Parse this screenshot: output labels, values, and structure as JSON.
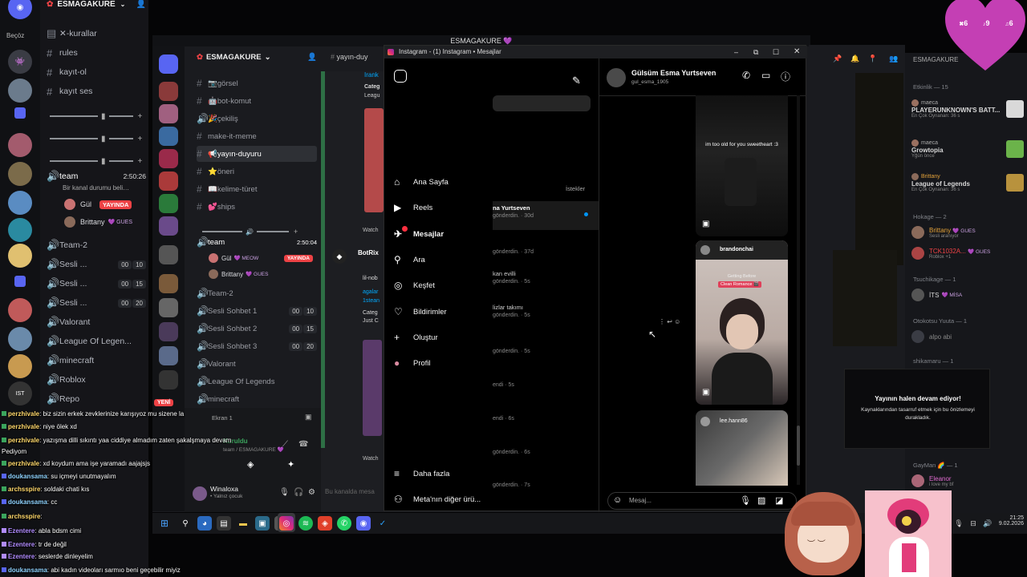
{
  "discord_rail": {
    "top_label": "Beçöz"
  },
  "discord_sidebar": {
    "server_name": "ESMAGAKURE",
    "channels": [
      {
        "icon": "#",
        "label": "✕-kurallar"
      },
      {
        "icon": "#",
        "label": "rules"
      },
      {
        "icon": "#",
        "label": "kayıt-ol"
      },
      {
        "icon": "#",
        "label": "kayıt ses"
      }
    ],
    "voice_team": {
      "name": "team",
      "time": "2:50:26",
      "status": "Bir kanal durumu beli…"
    },
    "voice_members": [
      {
        "name": "Gül",
        "badge": "YAYINDA"
      },
      {
        "name": "Brittany",
        "tag": "💜 GUES"
      }
    ],
    "voice_channels": [
      {
        "label": "Team-2"
      },
      {
        "label": "Sesli ...",
        "a": "00",
        "b": "10"
      },
      {
        "label": "Sesli ...",
        "a": "00",
        "b": "15"
      },
      {
        "label": "Sesli ...",
        "a": "00",
        "b": "20"
      },
      {
        "label": "Valorant"
      },
      {
        "label": "League Of Legen..."
      },
      {
        "label": "minecraft"
      },
      {
        "label": "Roblox"
      },
      {
        "label": "Repo"
      }
    ]
  },
  "discord_window": {
    "title": "ESMAGAKURE 💜",
    "server_name": "ESMAGAKURE",
    "channels": [
      {
        "icon": "#",
        "label": "📷görsel"
      },
      {
        "icon": "#",
        "label": "🤖bot-komut"
      },
      {
        "icon": "🔊",
        "label": "🎉çekiliş"
      },
      {
        "icon": "#",
        "label": "make-it-meme"
      },
      {
        "icon": "#",
        "label": "📢yayın-duyuru"
      },
      {
        "icon": "#",
        "label": "⭐öneri"
      },
      {
        "icon": "#",
        "label": "📖kelime-türet"
      },
      {
        "icon": "#",
        "label": "💕ships"
      }
    ],
    "voice_team": {
      "name": "team",
      "time": "2:50:04"
    },
    "voice_members": [
      {
        "name": "Gül",
        "tag": "💜 MEOW",
        "badge": "YAYINDA"
      },
      {
        "name": "Brittany",
        "tag": "💜 GUES"
      }
    ],
    "voice_channels": [
      {
        "label": "Team-2"
      },
      {
        "label": "Sesli Sohbet 1",
        "a": "00",
        "b": "10"
      },
      {
        "label": "Sesli Sohbet 2",
        "a": "00",
        "b": "15"
      },
      {
        "label": "Sesli Sohbet 3",
        "a": "00",
        "b": "20"
      },
      {
        "label": "Valorant"
      },
      {
        "label": "League Of Legends"
      },
      {
        "label": "minecraft"
      }
    ],
    "new_badge": "YENİ",
    "bot_name": "BotRix",
    "partial_texts": [
      "Irank",
      "Categ",
      "Leagu",
      "Watch",
      "lil-nob",
      "agalar",
      "1stean",
      "Categ",
      "Just C",
      "Watch"
    ],
    "channel_header": "yayın-duy",
    "user": {
      "name": "Winaloxa",
      "status": "• Yalnız çocuk"
    },
    "message_placeholder": "Bu kanalda mesa",
    "screen_label": "Ekran 1",
    "connected_label": "Kuruldu",
    "connected_sub": "team / ESMAGAKURE 💜"
  },
  "discord_members": {
    "server_name": "ESMAGAKURE",
    "activity_header": "Etkinlik — 15",
    "activities": [
      {
        "user": "maeca",
        "game": "PLAYERUNKNOWN'S BATT...",
        "detail": "En Çok Oynanan: 36 s",
        "game_color": "#d9d9d9"
      },
      {
        "user": "maeca",
        "game": "Growtopia",
        "detail": "Yğün önce",
        "game_color": "#6bb34a"
      },
      {
        "user": "Brittany",
        "game": "League of Legends",
        "detail": "En Çok Oynanan: 36 s",
        "game_color": "#b8923d"
      }
    ],
    "groups": [
      {
        "header": "Hokage — 2",
        "members": [
          {
            "name": "Brittany",
            "tag": "💜 GUES",
            "sub": "Sesli aranıyor"
          },
          {
            "name": "TCK1032A...",
            "tag": "💜 GUES",
            "sub": "Roblox +1"
          }
        ]
      },
      {
        "header": "Tsuchikage — 1",
        "members": [
          {
            "name": "İTS",
            "tag": "💜 MİSA",
            "sub": ""
          }
        ]
      },
      {
        "header": "Otokotsu Yuuta — 1",
        "members": [
          {
            "name": "alpo abi",
            "tag": "",
            "sub": ""
          }
        ]
      },
      {
        "header": "shikamaru — 1",
        "members": []
      },
      {
        "header": "GayMan 🌈 — 1",
        "members": [
          {
            "name": "Eleanor",
            "tag": "",
            "sub": "i love my bf"
          }
        ]
      }
    ]
  },
  "instagram": {
    "window_title": "Instagram - (1) Instagram • Mesajlar",
    "nav": [
      {
        "icon": "⌂",
        "label": "Ana Sayfa"
      },
      {
        "icon": "▶",
        "label": "Reels"
      },
      {
        "icon": "✈",
        "label": "Mesajlar"
      },
      {
        "icon": "⚲",
        "label": "Ara"
      },
      {
        "icon": "◎",
        "label": "Keşfet"
      },
      {
        "icon": "♡",
        "label": "Bildirimler"
      },
      {
        "icon": "+",
        "label": "Oluştur"
      },
      {
        "icon": "●",
        "label": "Profil"
      }
    ],
    "nav_bottom": [
      {
        "icon": "≡",
        "label": "Daha fazla"
      },
      {
        "icon": "⚇",
        "label": "Meta'nın diğer ürü..."
      }
    ],
    "requests_label": "İstekler",
    "conversations": [
      {
        "name": "na Yurtseven",
        "sub": "gönderdin. · 30d",
        "unread": true
      },
      {
        "name": "",
        "sub": "gönderdin. · 37d"
      },
      {
        "name": "kan evilli",
        "sub": "gönderdin. · 5s"
      },
      {
        "name": "lizlar takımı",
        "sub": "gönderdin. · 5s"
      },
      {
        "name": "",
        "sub": "gönderdin. · 5s"
      },
      {
        "name": "",
        "sub": "endi · 5s"
      },
      {
        "name": "",
        "sub": "endi · 6s"
      },
      {
        "name": "",
        "sub": "gönderdin. · 6s"
      },
      {
        "name": "",
        "sub": "gönderdin. · 7s"
      }
    ],
    "chat_header": {
      "name": "Gülsüm Esma Yurtseven",
      "handle": "gul_esma_1905"
    },
    "messages": [
      {
        "caption": "im too old for you sweetheart :3"
      },
      {
        "author": "brandonchai",
        "overlay": "Clean Romance 🎬",
        "overlay_top": "Getting Before"
      },
      {
        "author": "lee.hann86"
      }
    ],
    "message_placeholder": "Mesaj..."
  },
  "notification": {
    "title": "Yayının halen devam ediyor!",
    "body": "Kaynaklarından tasarruf etmek için bu önizlemeyi durakladık."
  },
  "chat_overlay": [
    {
      "user": "perzhivale",
      "text": "biz sizin erkek zevklerinize karışıyoz mu sizene la",
      "color": "#ffd86b"
    },
    {
      "user": "perzhivale",
      "text": "niye ölek xd",
      "color": "#ffd86b"
    },
    {
      "user": "perzhivale",
      "text": "yazışma dilli sıkıntı yaa ciddiye almadım zaten şakalşmaya devam",
      "color": "#ffd86b"
    },
    {
      "user": "",
      "text": "Pediyom",
      "color": "#ffffff"
    },
    {
      "user": "perzhivale",
      "text": "xd koydum ama işe yaramadı aajajsjs",
      "color": "#ffd86b"
    },
    {
      "user": "doukansama",
      "text": "su içmeyi unutmayalım",
      "color": "#8fd3ff"
    },
    {
      "user": "archsspire",
      "text": "soldaki chati kıs",
      "color": "#ffd86b"
    },
    {
      "user": "doukansama",
      "text": "cc",
      "color": "#8fd3ff"
    },
    {
      "user": "archsspire",
      "text": "",
      "color": "#ffd86b"
    },
    {
      "user": "Ezentere",
      "text": "abla bdsm cimi",
      "color": "#b18cff"
    },
    {
      "user": "Ezentere",
      "text": "tr de değil",
      "color": "#b18cff"
    },
    {
      "user": "Ezentere",
      "text": "seslerde dinleyelim",
      "color": "#b18cff"
    },
    {
      "user": "doukansama",
      "text": "abi kadın videoları sarmıo beni geçebilir miyiz",
      "color": "#8fd3ff"
    }
  ],
  "heart_widget": {
    "values": [
      "6",
      "9",
      "6"
    ]
  },
  "clock": {
    "time": "21:25",
    "date": "9.02.2026"
  },
  "colors": {
    "discord_bg": "#151519",
    "instagram_bg": "#000000",
    "live_red": "#ed4245",
    "heart": "#c43fb4"
  }
}
